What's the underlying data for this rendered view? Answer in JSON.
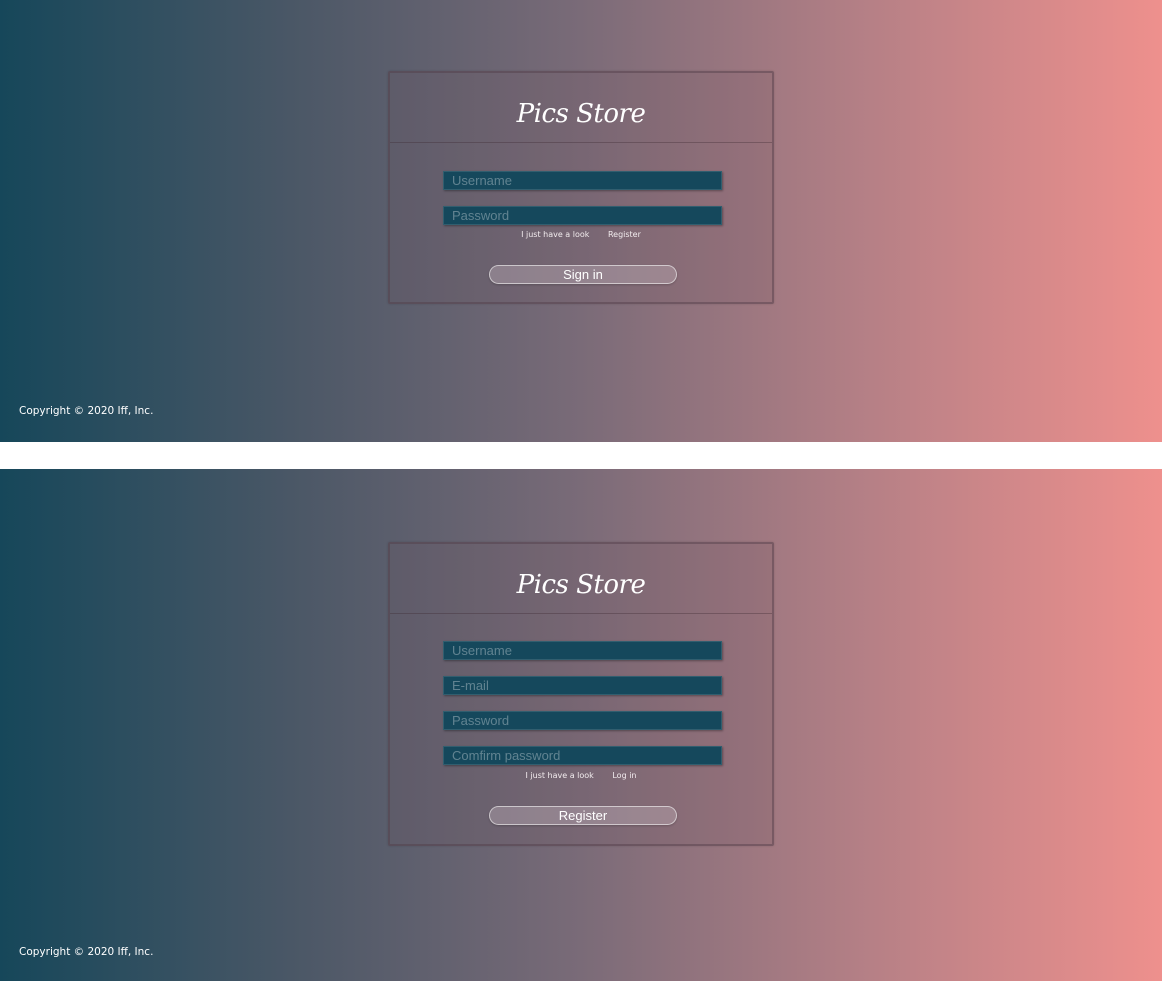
{
  "login_view": {
    "logo": "Pics Store",
    "username_placeholder": "Username",
    "password_placeholder": "Password",
    "look_link": "I just have a look",
    "register_link": "Register",
    "submit_label": "Sign in",
    "copyright": "Copyright © 2020 Iff, Inc."
  },
  "register_view": {
    "logo": "Pics Store",
    "username_placeholder": "Username",
    "email_placeholder": "E-mail",
    "password_placeholder": "Password",
    "confirm_placeholder": "Comfirm password",
    "look_link": "I just have a look",
    "login_link": "Log in",
    "submit_label": "Register",
    "copyright": "Copyright © 2020 Iff, Inc."
  },
  "colors": {
    "gradient_start": "#16475a",
    "gradient_end": "#ee908d",
    "field_bg": "#15485c"
  }
}
